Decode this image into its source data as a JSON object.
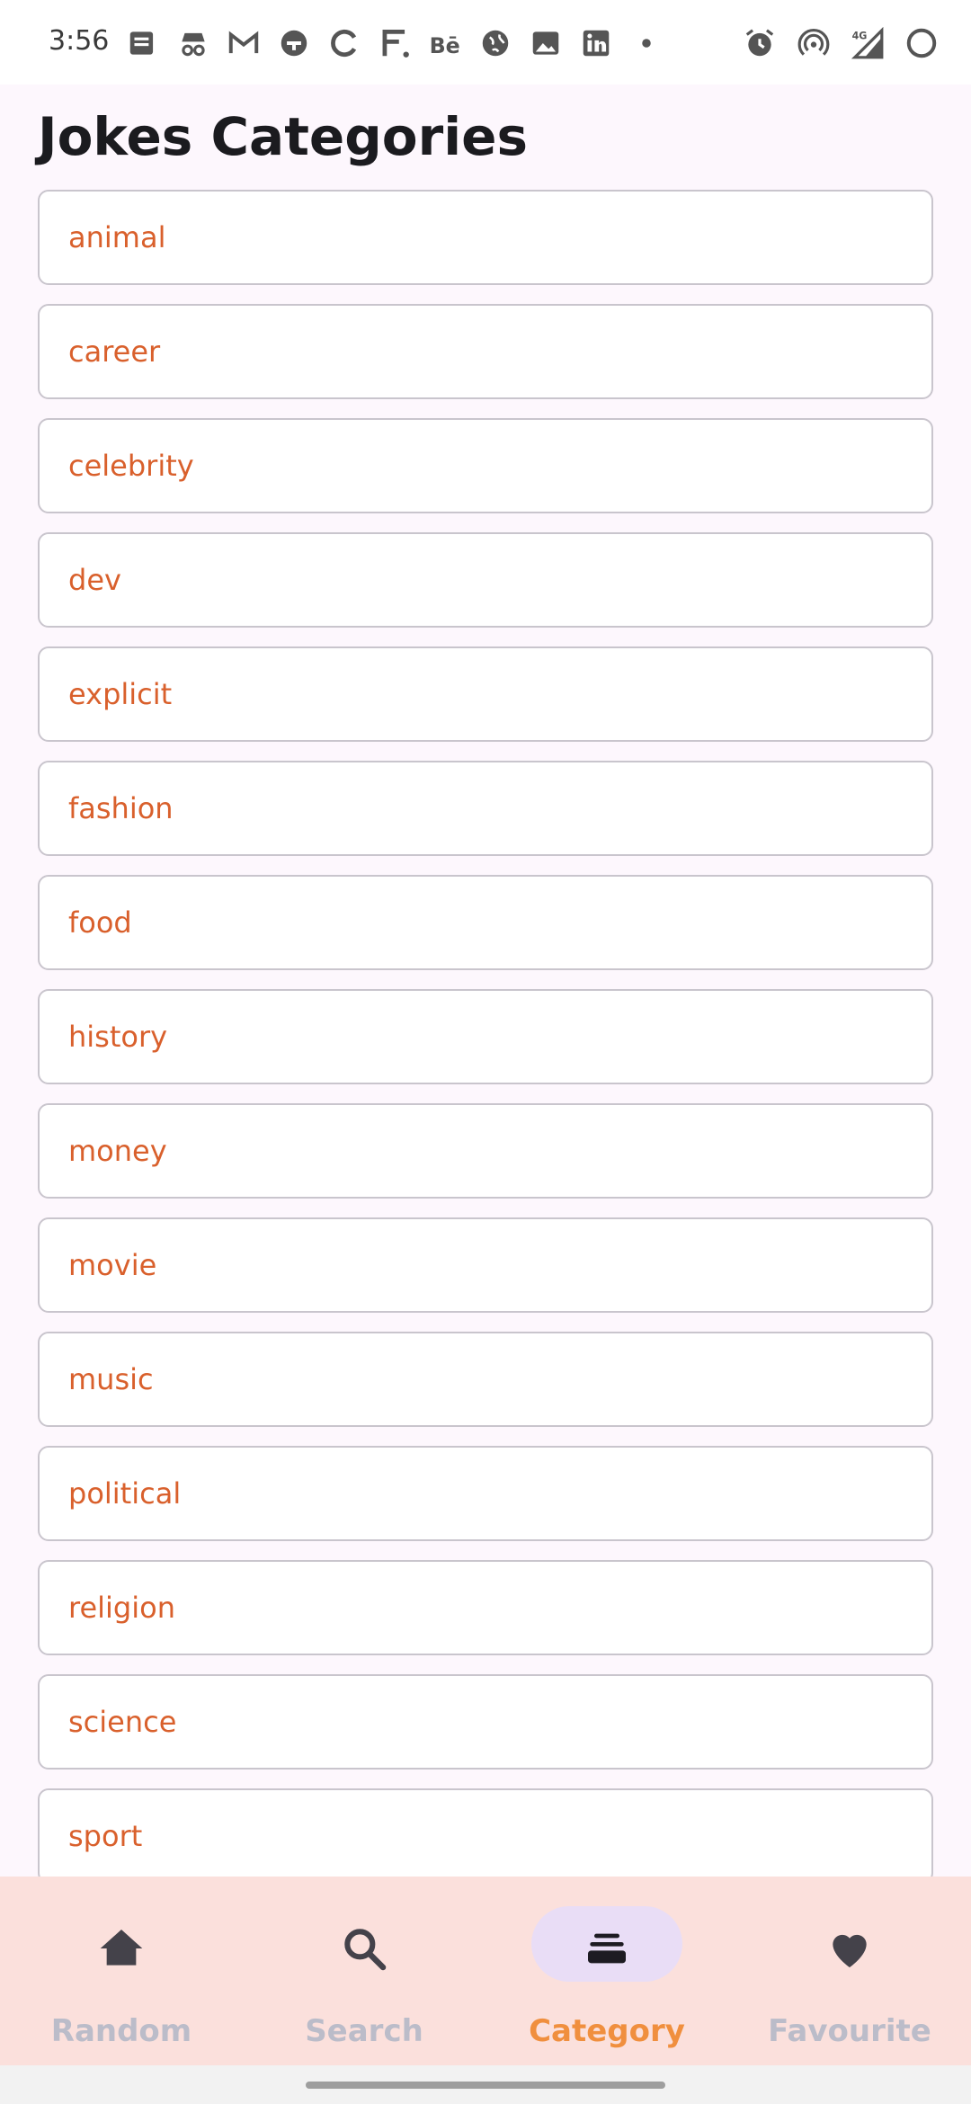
{
  "status_bar": {
    "time": "3:56",
    "left_icons": [
      "news-icon",
      "incognito-icon",
      "gmail-icon",
      "vpn-icon",
      "sync-icon",
      "f-app-icon",
      "behance-icon",
      "globe-icon",
      "image-icon",
      "linkedin-icon",
      "dot-icon"
    ],
    "right_icons": [
      "alarm-icon",
      "hotspot-icon",
      "signal-4g-icon",
      "battery-icon"
    ],
    "network": "4G"
  },
  "page": {
    "title": "Jokes Categories"
  },
  "categories": [
    "animal",
    "career",
    "celebrity",
    "dev",
    "explicit",
    "fashion",
    "food",
    "history",
    "money",
    "movie",
    "music",
    "political",
    "religion",
    "science",
    "sport"
  ],
  "bottom_nav": {
    "items": [
      {
        "label": "Random",
        "icon": "home-icon",
        "active": false
      },
      {
        "label": "Search",
        "icon": "search-icon",
        "active": false
      },
      {
        "label": "Category",
        "icon": "category-icon",
        "active": true
      },
      {
        "label": "Favourite",
        "icon": "heart-icon",
        "active": false
      }
    ]
  },
  "colors": {
    "accent": "#d9602c",
    "nav_active": "#f08f3e",
    "nav_inactive": "#bbbcc9",
    "nav_background": "#fbe0dc",
    "indicator": "#e9ddf6"
  }
}
